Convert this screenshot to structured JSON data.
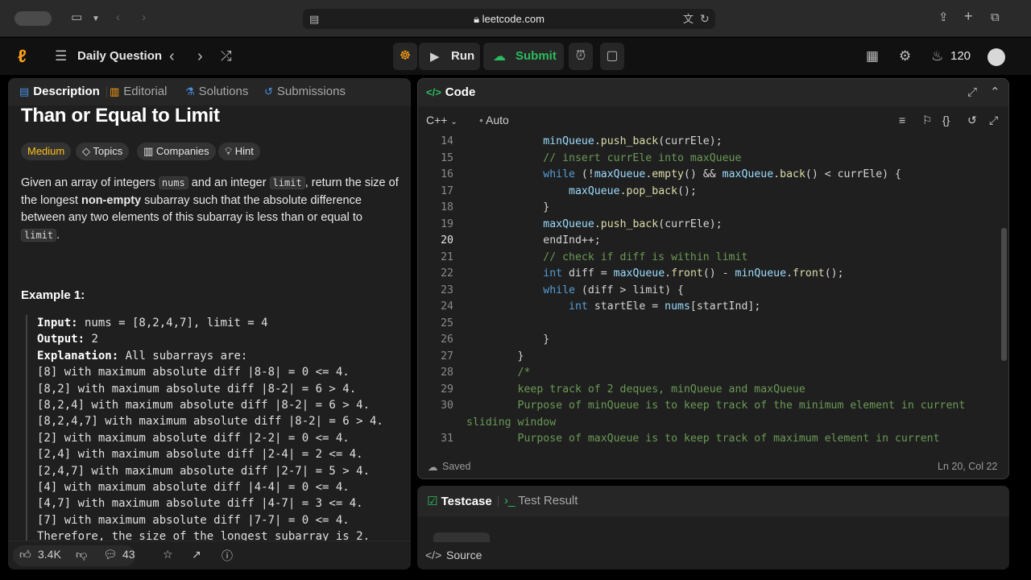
{
  "browser": {
    "url": "leetcode.com",
    "icons": [
      "sidebar-icon",
      "chevron-down-icon",
      "back-icon",
      "forward-icon",
      "lock-icon",
      "translate-icon",
      "reload-icon",
      "share-icon",
      "new-tab-icon",
      "tabs-icon"
    ]
  },
  "nav": {
    "daily_label": "Daily Question",
    "run_label": "Run",
    "submit_label": "Submit",
    "streak_count": "120",
    "accent_submit": "#2cbb5d"
  },
  "left": {
    "tabs": [
      {
        "label": "Description",
        "icon": "description-icon"
      },
      {
        "label": "Editorial",
        "icon": "book-icon"
      },
      {
        "label": "Solutions",
        "icon": "flask-icon"
      },
      {
        "label": "Submissions",
        "icon": "history-icon"
      }
    ],
    "title": "Than or Equal to Limit",
    "tags": {
      "difficulty": "Medium",
      "topics": "Topics",
      "companies": "Companies",
      "hint": "Hint"
    },
    "desc": {
      "p1": "Given an array of integers ",
      "nums": "nums",
      "p2": " and an integer ",
      "limit": "limit",
      "p3": ", return the size of the longest ",
      "bold": "non-empty",
      "p4": " subarray such that the absolute difference between any two elements of this subarray is less than or equal to ",
      "limit2": "limit",
      "p5": "."
    },
    "example_title": "Example 1:",
    "example": {
      "input_label": "Input:",
      "input_value": " nums = [8,2,4,7], limit = 4",
      "output_label": "Output:",
      "output_value": " 2",
      "explanation_label": "Explanation:",
      "explanation_value": " All subarrays are:",
      "lines": [
        "[8] with maximum absolute diff |8-8| = 0 <= 4.",
        "[8,2] with maximum absolute diff |8-2| = 6 > 4.",
        "[8,2,4] with maximum absolute diff |8-2| = 6 > 4.",
        "[8,2,4,7] with maximum absolute diff |8-2| = 6 > 4.",
        "[2] with maximum absolute diff |2-2| = 0 <= 4.",
        "[2,4] with maximum absolute diff |2-4| = 2 <= 4.",
        "[2,4,7] with maximum absolute diff |2-7| = 5 > 4.",
        "[4] with maximum absolute diff |4-4| = 0 <= 4.",
        "[4,7] with maximum absolute diff |4-7| = 3 <= 4.",
        "[7] with maximum absolute diff |7-7| = 0 <= 4.",
        "Therefore, the size of the longest subarray is 2."
      ]
    },
    "footer": {
      "likes": "3.4K",
      "comments": "43"
    }
  },
  "code": {
    "tab_label": "Code",
    "language": "C++",
    "auto_label": "Auto",
    "status_saved": "Saved",
    "cursor": "Ln 20, Col 22",
    "lines": [
      {
        "n": "14",
        "t": "            minQueue.push_back(currEle);"
      },
      {
        "n": "15",
        "t": "            // insert currEle into maxQueue"
      },
      {
        "n": "16",
        "t": "            while (!maxQueue.empty() && maxQueue.back() < currEle) {"
      },
      {
        "n": "17",
        "t": "                maxQueue.pop_back();"
      },
      {
        "n": "18",
        "t": "            }"
      },
      {
        "n": "19",
        "t": "            maxQueue.push_back(currEle);"
      },
      {
        "n": "20",
        "t": "            endInd++;"
      },
      {
        "n": "21",
        "t": "            // check if diff is within limit"
      },
      {
        "n": "22",
        "t": "            int diff = maxQueue.front() - minQueue.front();"
      },
      {
        "n": "23",
        "t": "            while (diff > limit) {"
      },
      {
        "n": "24",
        "t": "                int startEle = nums[startInd];"
      },
      {
        "n": "25",
        "t": ""
      },
      {
        "n": "26",
        "t": "            }"
      },
      {
        "n": "27",
        "t": "        }"
      },
      {
        "n": "28",
        "t": "        /*"
      },
      {
        "n": "29",
        "t": "        keep track of 2 deques, minQueue and maxQueue"
      },
      {
        "n": "30",
        "t": "        Purpose of minQueue is to keep track of the minimum element in current"
      },
      {
        "n": "",
        "t": "sliding window"
      },
      {
        "n": "31",
        "t": "        Purpose of maxQueue is to keep track of maximum element in current"
      }
    ]
  },
  "test": {
    "testcase_label": "Testcase",
    "result_label": "Test Result",
    "source_label": "Source"
  }
}
